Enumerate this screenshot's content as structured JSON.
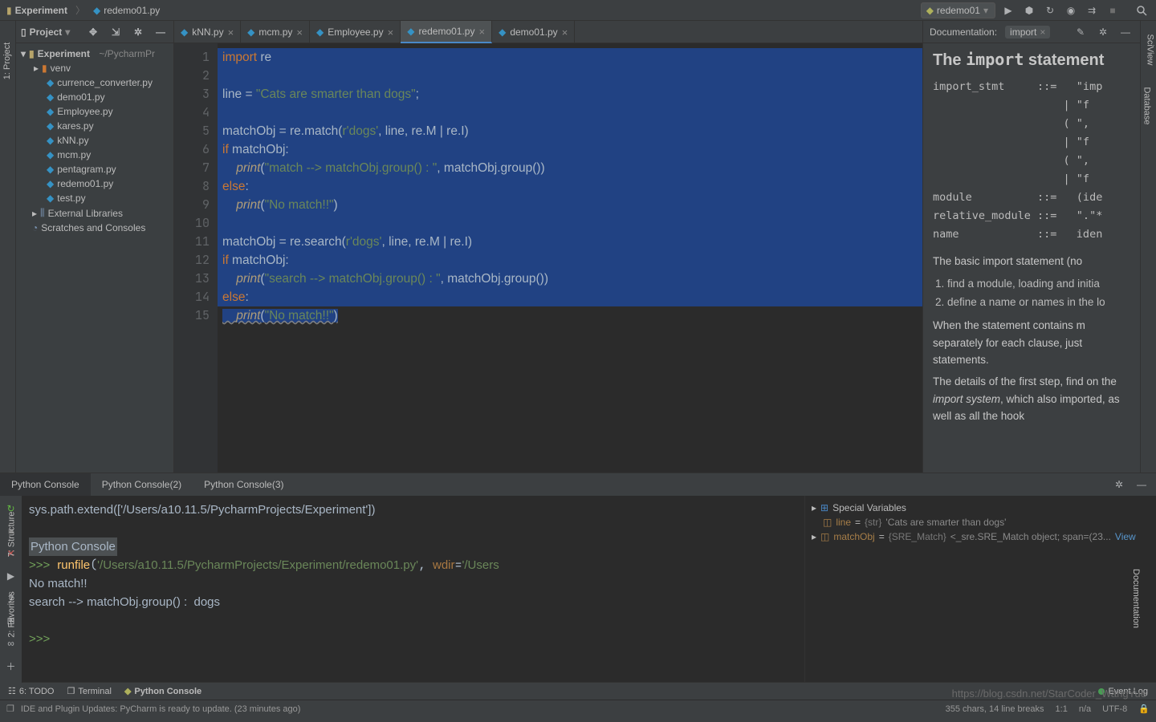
{
  "breadcrumb": {
    "project": "Experiment",
    "file": "redemo01.py"
  },
  "run_config": {
    "name": "redemo01"
  },
  "left_stripe": {
    "project": "1: Project",
    "structure": "7: Structure",
    "favorites": "2: Favorites"
  },
  "right_stripe": {
    "sciview": "SciView",
    "database": "Database",
    "documentation": "Documentation"
  },
  "project_panel": {
    "title": "Project",
    "root": {
      "name": "Experiment",
      "path": "~/PycharmPr"
    },
    "venv": "venv",
    "files": [
      "currence_converter.py",
      "demo01.py",
      "Employee.py",
      "kares.py",
      "kNN.py",
      "mcm.py",
      "pentagram.py",
      "redemo01.py",
      "test.py"
    ],
    "external": "External Libraries",
    "scratches": "Scratches and Consoles"
  },
  "tabs": [
    {
      "name": "kNN.py",
      "active": false
    },
    {
      "name": "mcm.py",
      "active": false
    },
    {
      "name": "Employee.py",
      "active": false
    },
    {
      "name": "redemo01.py",
      "active": true
    },
    {
      "name": "demo01.py",
      "active": false
    }
  ],
  "code_lines": [
    {
      "n": 1,
      "tokens": [
        [
          "kw",
          "import"
        ],
        [
          "txt",
          " re"
        ]
      ]
    },
    {
      "n": 2,
      "tokens": []
    },
    {
      "n": 3,
      "tokens": [
        [
          "txt",
          "line "
        ],
        [
          "txt",
          "="
        ],
        [
          "txt",
          " "
        ],
        [
          "str",
          "\"Cats are smarter than dogs\""
        ],
        [
          "txt",
          ";"
        ]
      ]
    },
    {
      "n": 4,
      "tokens": []
    },
    {
      "n": 5,
      "tokens": [
        [
          "txt",
          "matchObj "
        ],
        [
          "txt",
          "="
        ],
        [
          "txt",
          " re.match("
        ],
        [
          "str",
          "r'dogs'"
        ],
        [
          "txt",
          ", line, re.M | re.I)"
        ]
      ]
    },
    {
      "n": 6,
      "tokens": [
        [
          "kw",
          "if"
        ],
        [
          "txt",
          " matchObj:"
        ]
      ]
    },
    {
      "n": 7,
      "tokens": [
        [
          "txt",
          "    "
        ],
        [
          "fn2",
          "print"
        ],
        [
          "txt",
          "("
        ],
        [
          "str",
          "\"match --> matchObj.group() : \""
        ],
        [
          "txt",
          ", matchObj.group())"
        ]
      ]
    },
    {
      "n": 8,
      "tokens": [
        [
          "kw",
          "else"
        ],
        [
          "txt",
          ":"
        ]
      ]
    },
    {
      "n": 9,
      "tokens": [
        [
          "txt",
          "    "
        ],
        [
          "fn2",
          "print"
        ],
        [
          "txt",
          "("
        ],
        [
          "str",
          "\"No match!!\""
        ],
        [
          "txt",
          ")"
        ]
      ]
    },
    {
      "n": 10,
      "tokens": []
    },
    {
      "n": 11,
      "tokens": [
        [
          "txt",
          "matchObj "
        ],
        [
          "txt",
          "="
        ],
        [
          "txt",
          " re.search("
        ],
        [
          "str",
          "r'dogs'"
        ],
        [
          "txt",
          ", line, re.M | re.I)"
        ]
      ]
    },
    {
      "n": 12,
      "tokens": [
        [
          "kw",
          "if"
        ],
        [
          "txt",
          " matchObj:"
        ]
      ]
    },
    {
      "n": 13,
      "tokens": [
        [
          "txt",
          "    "
        ],
        [
          "fn2",
          "print"
        ],
        [
          "txt",
          "("
        ],
        [
          "str",
          "\"search --> matchObj.group() : \""
        ],
        [
          "txt",
          ", matchObj.group())"
        ]
      ]
    },
    {
      "n": 14,
      "tokens": [
        [
          "kw",
          "else"
        ],
        [
          "txt",
          ":"
        ]
      ]
    },
    {
      "n": 15,
      "tokens": [
        [
          "txt",
          "    "
        ],
        [
          "fn2",
          "print"
        ],
        [
          "txt",
          "("
        ],
        [
          "str",
          "\"No match!!\""
        ],
        [
          "txt",
          ")"
        ]
      ],
      "last": true
    }
  ],
  "doc": {
    "header_label": "Documentation:",
    "tag": "import",
    "title_pre": "The ",
    "title_kw": "import",
    "title_post": " statement",
    "grammar": "import_stmt     ::=   \"imp\n                    | \"f\n                    ( \",\n                    | \"f\n                    ( \",\n                    | \"f\nmodule          ::=   (ide\nrelative_module ::=   \".\"*\nname            ::=   iden",
    "para1": "The basic import statement (no",
    "li1": "find a module, loading and initia",
    "li2": "define a name or names in the lo",
    "para2": "When the statement contains m separately for each clause, just statements.",
    "para3_a": "The details of the first step, find on the ",
    "para3_em": "import system",
    "para3_b": ", which also imported, as well as all the hook"
  },
  "console": {
    "tabs": [
      "Python Console",
      "Python Console(2)",
      "Python Console(3)"
    ],
    "active_tab": 0,
    "out_line1": "sys.path.extend(['/Users/a10.11.5/PycharmProjects/Experiment'])",
    "out_header": "Python Console",
    "out_run": ">>> runfile('/Users/a10.11.5/PycharmProjects/Experiment/redemo01.py', wdir='/Users",
    "out_nm": "No match!!",
    "out_search": "search --> matchObj.group() :  dogs",
    "prompt": ">>> ",
    "vars": {
      "special": "Special Variables",
      "line_name": "line",
      "line_type": "{str}",
      "line_val": "'Cats are smarter than dogs'",
      "mo_name": "matchObj",
      "mo_type": "{SRE_Match}",
      "mo_val": "<_sre.SRE_Match object; span=(23...",
      "view": "View"
    }
  },
  "tool_tabs": {
    "todo": "6: TODO",
    "terminal": "Terminal",
    "python_console": "Python Console",
    "event_log": "Event Log"
  },
  "status": {
    "message": "IDE and Plugin Updates: PyCharm is ready to update. (23 minutes ago)",
    "chars": "355 chars, 14 line breaks",
    "pos": "1:1",
    "na": "n/a",
    "enc": "UTF-8",
    "lock": "🔒"
  },
  "watermark": "https://blog.csdn.net/StarCoder_WangYue"
}
